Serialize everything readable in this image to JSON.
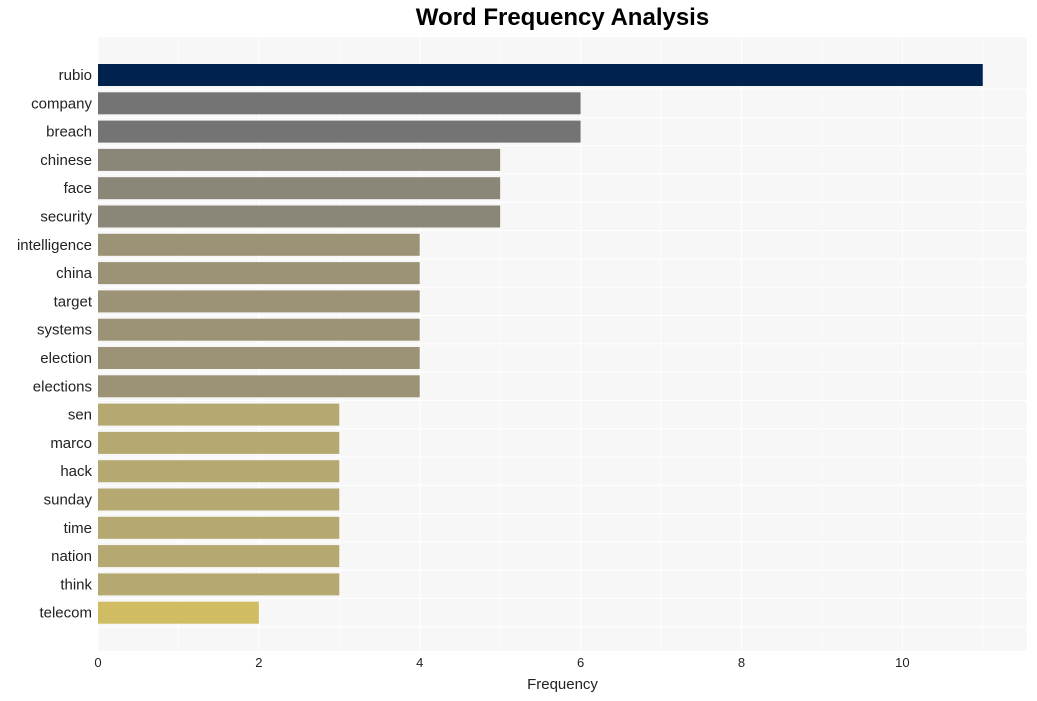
{
  "chart_data": {
    "type": "bar",
    "orientation": "horizontal",
    "title": "Word Frequency Analysis",
    "xlabel": "Frequency",
    "ylabel": "",
    "xlim": [
      0,
      11.55
    ],
    "xticks": [
      0,
      2,
      4,
      6,
      8,
      10
    ],
    "grid": true,
    "categories": [
      "rubio",
      "company",
      "breach",
      "chinese",
      "face",
      "security",
      "intelligence",
      "china",
      "target",
      "systems",
      "election",
      "elections",
      "sen",
      "marco",
      "hack",
      "sunday",
      "time",
      "nation",
      "think",
      "telecom"
    ],
    "values": [
      11,
      6,
      6,
      5,
      5,
      5,
      4,
      4,
      4,
      4,
      4,
      4,
      3,
      3,
      3,
      3,
      3,
      3,
      3,
      2
    ],
    "colors": [
      "#00224e",
      "#747474",
      "#747474",
      "#8a8778",
      "#8a8778",
      "#8a8778",
      "#9c9377",
      "#9c9377",
      "#9c9377",
      "#9c9377",
      "#9c9377",
      "#9c9377",
      "#b5a871",
      "#b5a871",
      "#b5a871",
      "#b5a871",
      "#b5a871",
      "#b5a871",
      "#b5a871",
      "#cfbc63"
    ]
  }
}
